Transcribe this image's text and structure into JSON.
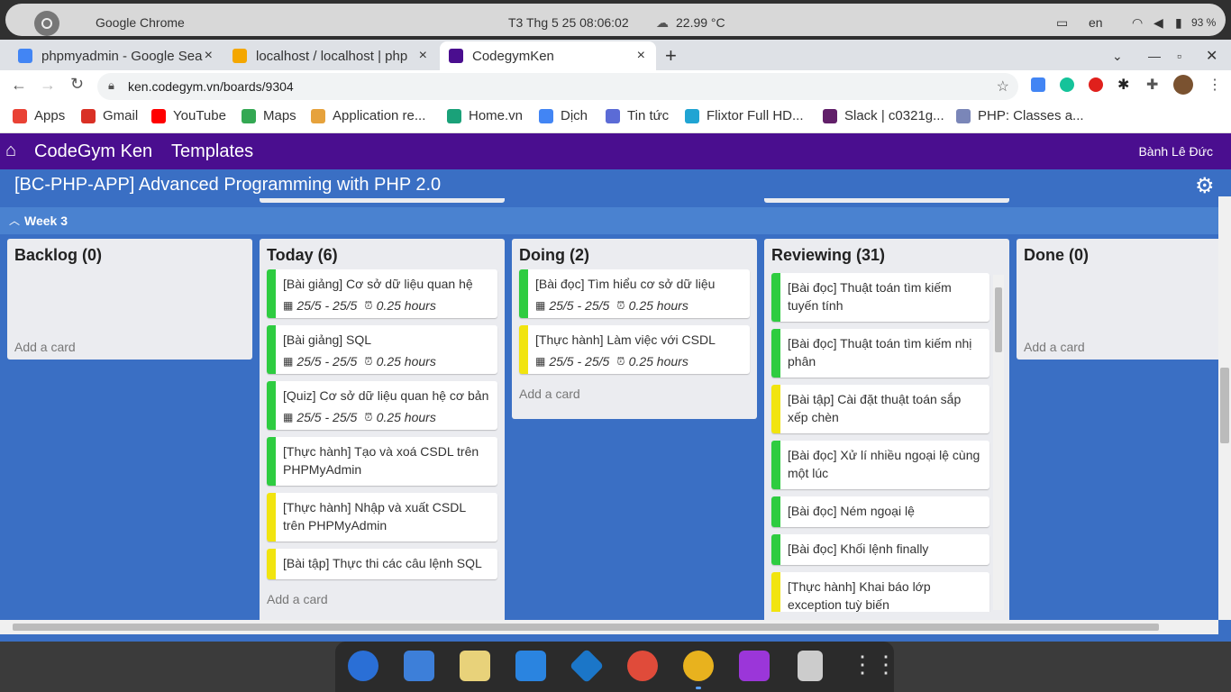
{
  "system_bar": {
    "app_name": "Google Chrome",
    "datetime": "T3 Thg 5 25  08:06:02",
    "weather": "22.99 °C",
    "language": "en",
    "battery": "93 %"
  },
  "tabs": [
    {
      "label": "phpmyadmin - Google Sea",
      "close": "×"
    },
    {
      "label": "localhost / localhost | php",
      "close": "×"
    },
    {
      "label": "CodegymKen",
      "close": "×"
    }
  ],
  "new_tab": "+",
  "url": "ken.codegym.vn/boards/9304",
  "bookmarks": [
    {
      "label": "Apps",
      "color": "#e94235"
    },
    {
      "label": "Gmail",
      "color": "#d93025"
    },
    {
      "label": "YouTube",
      "color": "#ff0000"
    },
    {
      "label": "Maps",
      "color": "#34a853"
    },
    {
      "label": "Application re...",
      "color": "#e6a23c"
    },
    {
      "label": "Home.vn",
      "color": "#1aa179"
    },
    {
      "label": "Dịch",
      "color": "#4285f4"
    },
    {
      "label": "Tin tức",
      "color": "#5b6bd6"
    },
    {
      "label": "Flixtor Full HD...",
      "color": "#20a4d3"
    },
    {
      "label": "Slack | c0321g...",
      "color": "#611f69"
    },
    {
      "label": "PHP: Classes a...",
      "color": "#7a86b8"
    }
  ],
  "nav": {
    "brand": "CodeGym Ken",
    "templates": "Templates",
    "user": "Bành Lê Đức"
  },
  "board": {
    "title": "[BC-PHP-APP] Advanced Programming with PHP 2.0",
    "week": "Week 3",
    "add_card": "Add a card",
    "lists": [
      {
        "title": "Backlog (0)",
        "cards": []
      },
      {
        "title": "Today (6)",
        "cards": [
          {
            "title": "[Bài giảng] Cơ sở dữ liệu quan hệ",
            "date": "25/5 - 25/5",
            "time": "0.25 hours",
            "color": "#2ecc40"
          },
          {
            "title": "[Bài giảng] SQL",
            "date": "25/5 - 25/5",
            "time": "0.25 hours",
            "color": "#2ecc40"
          },
          {
            "title": "[Quiz] Cơ sở dữ liệu quan hệ cơ bản",
            "date": "25/5 - 25/5",
            "time": "0.25 hours",
            "color": "#2ecc40"
          },
          {
            "title": "[Thực hành] Tạo và xoá CSDL trên PHPMyAdmin",
            "color": "#2ecc40"
          },
          {
            "title": "[Thực hành] Nhập và xuất CSDL trên PHPMyAdmin",
            "color": "#f1e40f"
          },
          {
            "title": "[Bài tập] Thực thi các câu lệnh SQL",
            "color": "#f1e40f"
          }
        ]
      },
      {
        "title": "Doing (2)",
        "cards": [
          {
            "title": "[Bài đọc] Tìm hiểu cơ sở dữ liệu",
            "date": "25/5 - 25/5",
            "time": "0.25 hours",
            "color": "#2ecc40"
          },
          {
            "title": "[Thực hành] Làm việc với CSDL",
            "date": "25/5 - 25/5",
            "time": "0.25 hours",
            "color": "#f1e40f"
          }
        ]
      },
      {
        "title": "Reviewing (31)",
        "cards": [
          {
            "title": "[Bài đọc] Thuật toán tìm kiếm tuyến tính",
            "color": "#2ecc40"
          },
          {
            "title": "[Bài đọc] Thuật toán tìm kiếm nhị phân",
            "color": "#2ecc40"
          },
          {
            "title": "[Bài tập] Cài đặt thuật toán sắp xếp chèn",
            "color": "#f1e40f"
          },
          {
            "title": "[Bài đọc] Xử lí nhiều ngoại lệ cùng một lúc",
            "color": "#2ecc40"
          },
          {
            "title": "[Bài đọc] Ném ngoại lệ",
            "color": "#2ecc40"
          },
          {
            "title": "[Bài đọc] Khối lệnh finally",
            "color": "#2ecc40"
          },
          {
            "title": "[Thực hành] Khai báo lớp exception tuỳ biến",
            "color": "#f1e40f"
          }
        ]
      },
      {
        "title": "Done (0)",
        "cards": []
      }
    ]
  },
  "dock_apps": [
    {
      "name": "thunderbird-icon",
      "color": "#2a6fd6"
    },
    {
      "name": "files-icon",
      "color": "#3d7fd9"
    },
    {
      "name": "rhythmbox-icon",
      "color": "#e8d27a"
    },
    {
      "name": "writer-icon",
      "color": "#2a84e0"
    },
    {
      "name": "vscode-icon",
      "color": "#1b76c8"
    },
    {
      "name": "help-icon",
      "color": "#e04b3a"
    },
    {
      "name": "chrome-icon",
      "color": "#e8b21e"
    },
    {
      "name": "phpstorm-icon",
      "color": "#9b36d9"
    },
    {
      "name": "trash-icon",
      "color": "#cccccc"
    },
    {
      "name": "apps-grid-icon",
      "color": "#dddddd"
    }
  ]
}
